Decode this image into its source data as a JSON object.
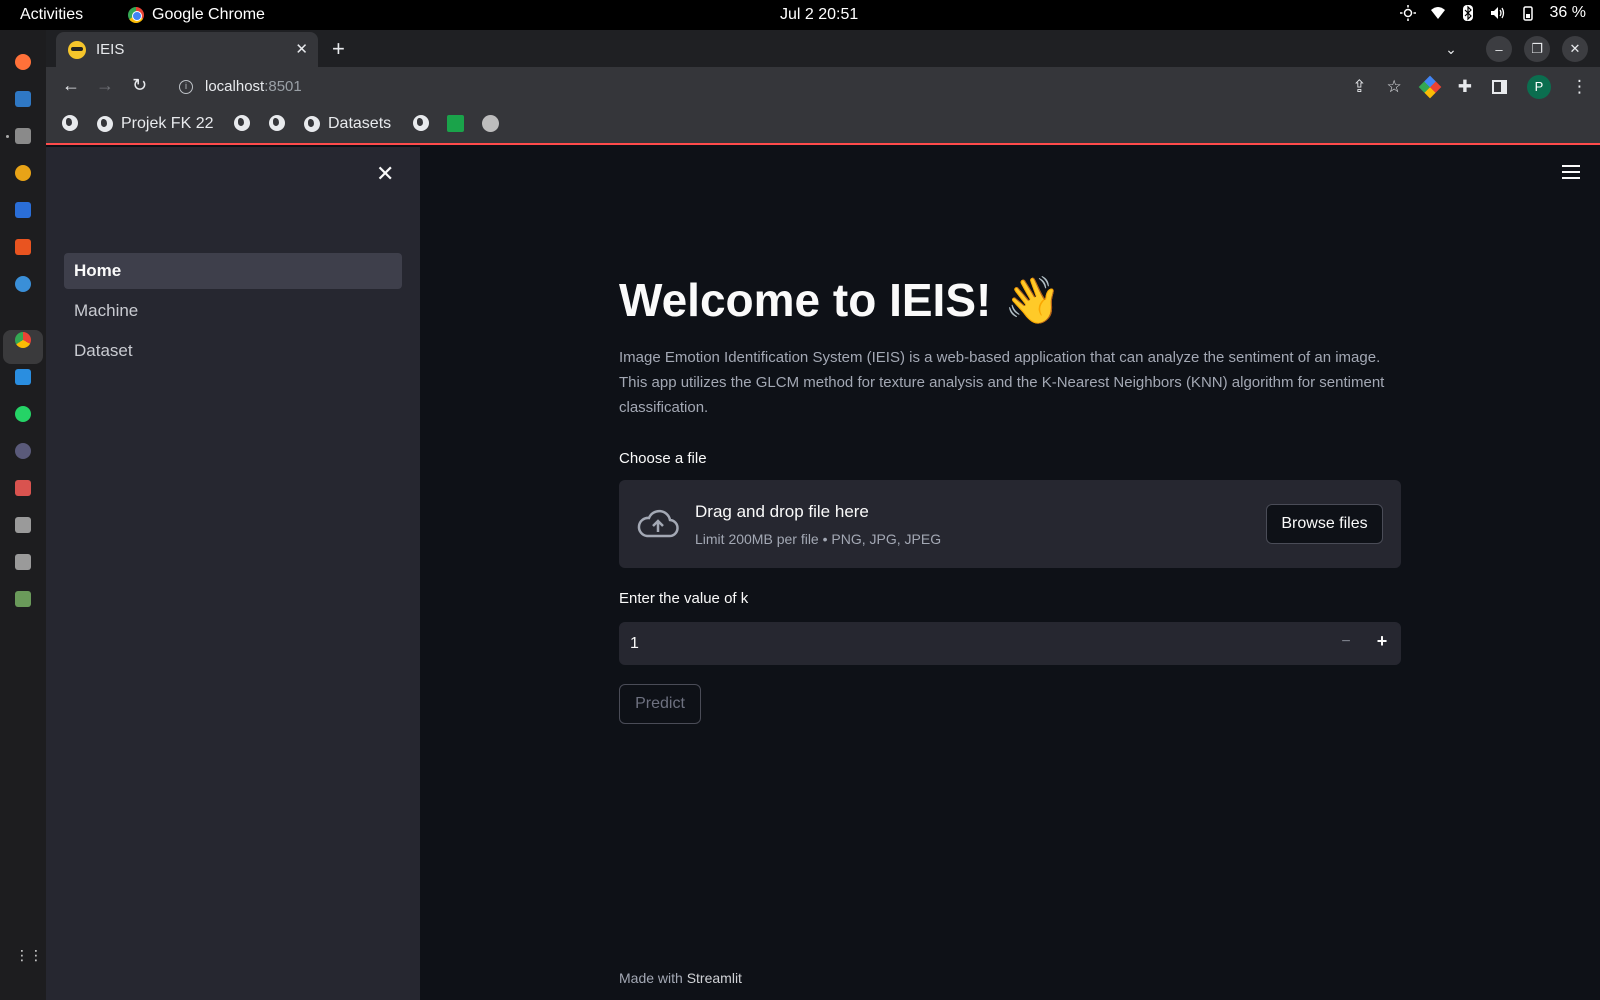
{
  "system": {
    "activities": "Activities",
    "app_name": "Google Chrome",
    "clock": "Jul 2  20:51",
    "battery": "36 %"
  },
  "browser": {
    "tab_title": "IEIS",
    "url_host": "localhost",
    "url_port": ":8501",
    "profile_initial": "P",
    "bookmarks": [
      "Projek FK 22",
      "Datasets"
    ]
  },
  "sidebar": {
    "items": [
      {
        "label": "Home",
        "active": true
      },
      {
        "label": "Machine",
        "active": false
      },
      {
        "label": "Dataset",
        "active": false
      }
    ]
  },
  "main": {
    "title": "Welcome to IEIS! 👋",
    "description": "Image Emotion Identification System (IEIS) is a web-based application that can analyze the sentiment of an image. This app utilizes the GLCM method for texture analysis and the K-Nearest Neighbors (KNN) algorithm for sentiment classification.",
    "file_label": "Choose a file",
    "dropzone_title": "Drag and drop file here",
    "dropzone_limit": "Limit 200MB per file • PNG, JPG, JPEG",
    "browse_label": "Browse files",
    "k_label": "Enter the value of k",
    "k_value": "1",
    "predict_label": "Predict",
    "footer_prefix": "Made with ",
    "footer_brand": "Streamlit"
  },
  "colors": {
    "accent": "#ff4b4b",
    "background": "#0e1117",
    "sidebar": "#262730"
  }
}
